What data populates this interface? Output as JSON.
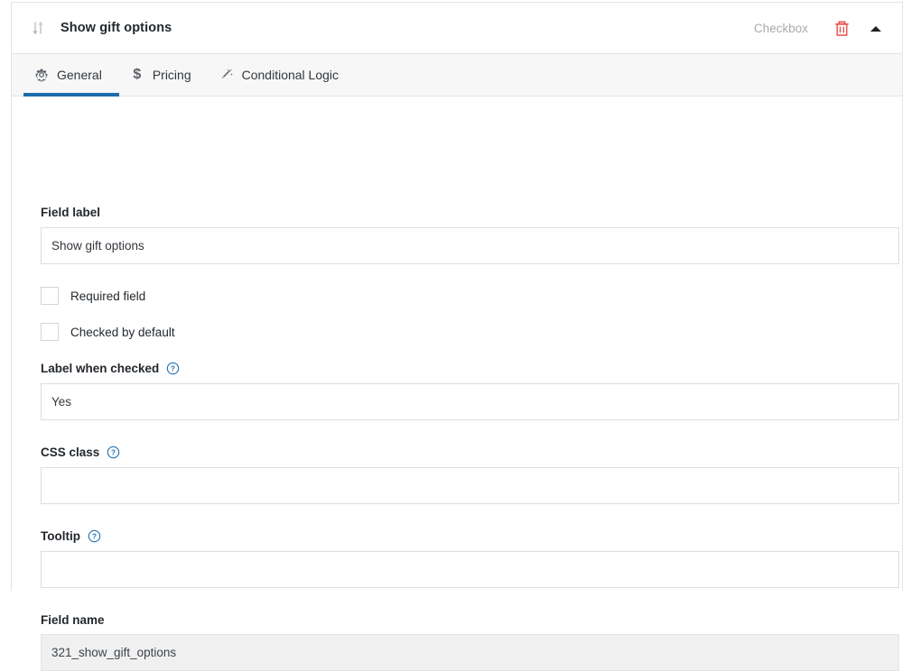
{
  "header": {
    "drag_handle_icon": "sort-drag-icon",
    "title": "Show gift options",
    "field_type": "Checkbox",
    "delete_icon": "trash-icon",
    "collapse_icon": "caret-up-icon"
  },
  "tabs": [
    {
      "id": "general",
      "label": "General",
      "icon": "gear-icon",
      "active": true
    },
    {
      "id": "pricing",
      "label": "Pricing",
      "icon": "dollar-icon",
      "active": false
    },
    {
      "id": "conditional-logic",
      "label": "Conditional Logic",
      "icon": "magic-wand-icon",
      "active": false
    }
  ],
  "form": {
    "field_label": {
      "label": "Field label",
      "value": "Show gift options",
      "placeholder": ""
    },
    "required_field": {
      "label": "Required field",
      "checked": false
    },
    "checked_by_default": {
      "label": "Checked by default",
      "checked": false
    },
    "label_when_checked": {
      "label": "Label when checked",
      "help_icon": "help-circle-icon",
      "value": "Yes",
      "placeholder": ""
    },
    "css_class": {
      "label": "CSS class",
      "help_icon": "help-circle-icon",
      "value": "",
      "placeholder": ""
    },
    "tooltip": {
      "label": "Tooltip",
      "help_icon": "help-circle-icon",
      "value": "",
      "placeholder": ""
    },
    "field_name": {
      "label": "Field name",
      "value": "321_show_gift_options",
      "readonly": true
    }
  },
  "colors": {
    "accent_blue": "#1c6cab",
    "help_blue": "#2271b1",
    "delete_red": "#e84d4d",
    "panel_border": "#e2e4e7",
    "tab_bar_bg": "#f7f7f7",
    "readonly_bg": "#f0f0f1",
    "muted_text": "#a7aaad"
  }
}
